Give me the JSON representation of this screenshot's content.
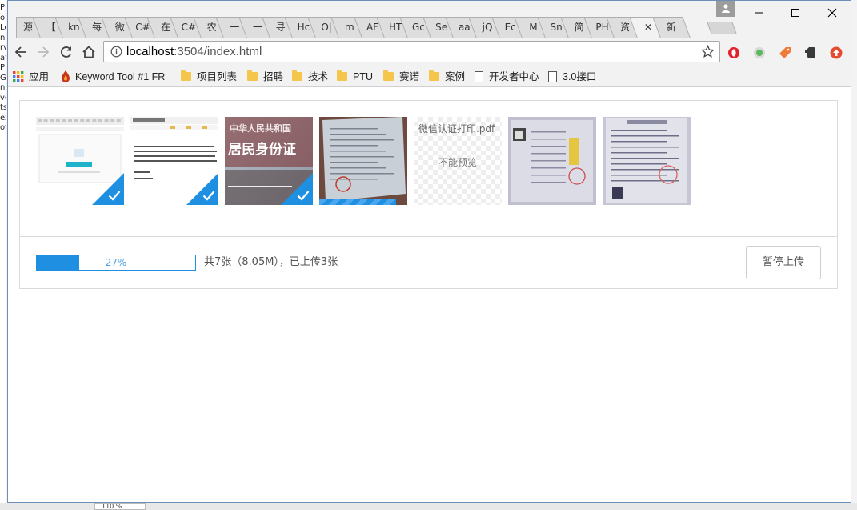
{
  "desktop": {
    "left_fragments": [
      "P",
      "or",
      "Le",
      "ne",
      "rv",
      "atr",
      "P",
      "G",
      "n",
      "ve",
      "ts",
      "ex",
      "of"
    ],
    "zoom_text": "110 %"
  },
  "tabs": [
    "源",
    "【",
    "kn",
    "每",
    "微",
    "C#",
    "在",
    "C#",
    "农",
    "一",
    "一",
    "寻",
    "Hc",
    "O|",
    "m",
    "AF",
    "HT",
    "Gc",
    "Se",
    "aa",
    "jQ",
    "Ec",
    "M",
    "Sn",
    "简",
    "PH",
    "资",
    "✕",
    "新"
  ],
  "active_tab_index": 27,
  "address_bar": {
    "host": "localhost",
    "path": ":3504/index.html"
  },
  "bookmarks": [
    {
      "label": "应用",
      "type": "apps"
    },
    {
      "label": "Keyword Tool #1 FR",
      "type": "site"
    },
    {
      "label": "项目列表",
      "type": "folder"
    },
    {
      "label": "招聘",
      "type": "folder"
    },
    {
      "label": "技术",
      "type": "folder"
    },
    {
      "label": "PTU",
      "type": "folder"
    },
    {
      "label": "赛诺",
      "type": "folder"
    },
    {
      "label": "案例",
      "type": "folder"
    },
    {
      "label": "开发者中心",
      "type": "page"
    },
    {
      "label": "3.0接口",
      "type": "page"
    }
  ],
  "uploader": {
    "files": [
      {
        "kind": "screenshot-upload-page",
        "status": "uploaded"
      },
      {
        "kind": "screenshot-text-page",
        "status": "uploaded"
      },
      {
        "kind": "id-card",
        "status": "uploaded",
        "caption_line1": "中华人民共和国",
        "caption_line2": "居民身份证"
      },
      {
        "kind": "document-photo",
        "status": "uploading"
      },
      {
        "kind": "pdf",
        "status": "pending",
        "name": "微信认证打印.pdf",
        "preview_text": "不能预览"
      },
      {
        "kind": "certificate-photo",
        "status": "pending"
      },
      {
        "kind": "certificate-photo-2",
        "status": "pending"
      }
    ],
    "progress_percent": 27,
    "progress_label": "27%",
    "info": "共7张（8.05M），已上传3张",
    "pause_button": "暂停上传"
  },
  "colors": {
    "accent": "#1e8fe1"
  }
}
